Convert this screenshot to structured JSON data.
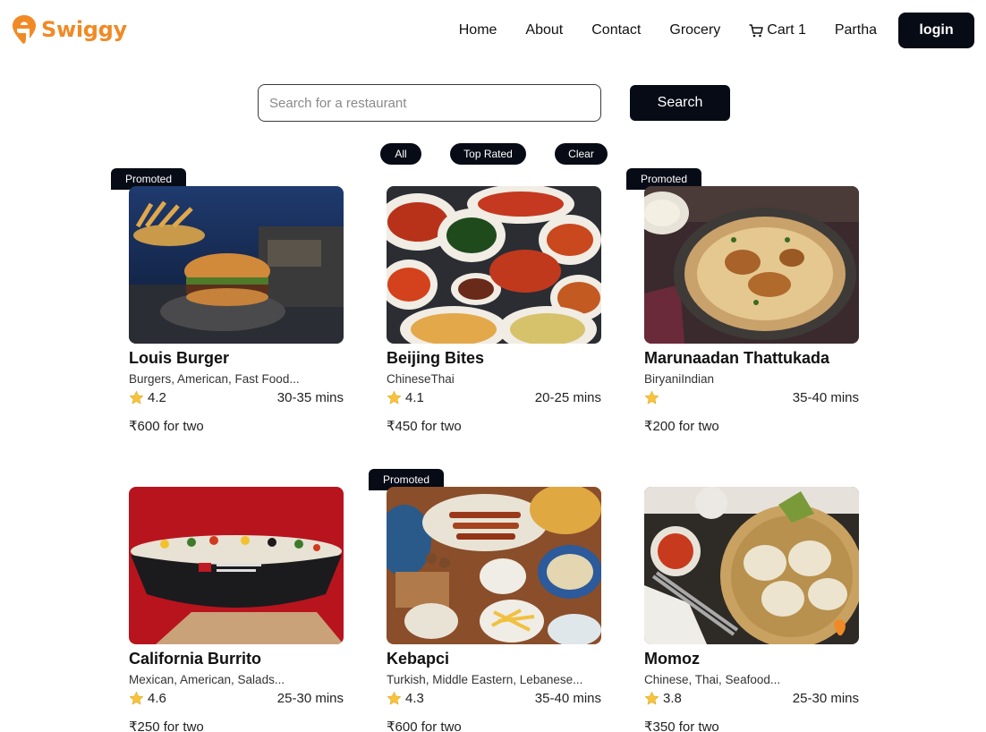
{
  "brand": {
    "name": "Swiggy",
    "color": "#f08a26"
  },
  "nav": {
    "home": "Home",
    "about": "About",
    "contact": "Contact",
    "grocery": "Grocery",
    "cart": "Cart 1",
    "user": "Partha",
    "login": "login"
  },
  "search": {
    "placeholder": "Search for a restaurant",
    "value": "",
    "button": "Search"
  },
  "filters": {
    "all": "All",
    "top_rated": "Top Rated",
    "clear": "Clear"
  },
  "promo_label": "Promoted",
  "restaurants": [
    {
      "name": "Louis Burger",
      "cuisine": "Burgers, American, Fast Food...",
      "rating": "4.2",
      "time": "30-35 mins",
      "price": "₹600 for two",
      "promoted": true
    },
    {
      "name": "Beijing Bites",
      "cuisine": "ChineseThai",
      "rating": "4.1",
      "time": "20-25 mins",
      "price": "₹450 for two",
      "promoted": false
    },
    {
      "name": "Marunaadan Thattukada",
      "cuisine": "BiryaniIndian",
      "rating": "",
      "time": "35-40 mins",
      "price": "₹200 for two",
      "promoted": true
    },
    {
      "name": "California Burrito",
      "cuisine": "Mexican, American, Salads...",
      "rating": "4.6",
      "time": "25-30 mins",
      "price": "₹250 for two",
      "promoted": false
    },
    {
      "name": "Kebapci",
      "cuisine": "Turkish, Middle Eastern, Lebanese...",
      "rating": "4.3",
      "time": "35-40 mins",
      "price": "₹600 for two",
      "promoted": true
    },
    {
      "name": "Momoz",
      "cuisine": "Chinese, Thai, Seafood...",
      "rating": "3.8",
      "time": "25-30 mins",
      "price": "₹350 for two",
      "promoted": false
    }
  ]
}
